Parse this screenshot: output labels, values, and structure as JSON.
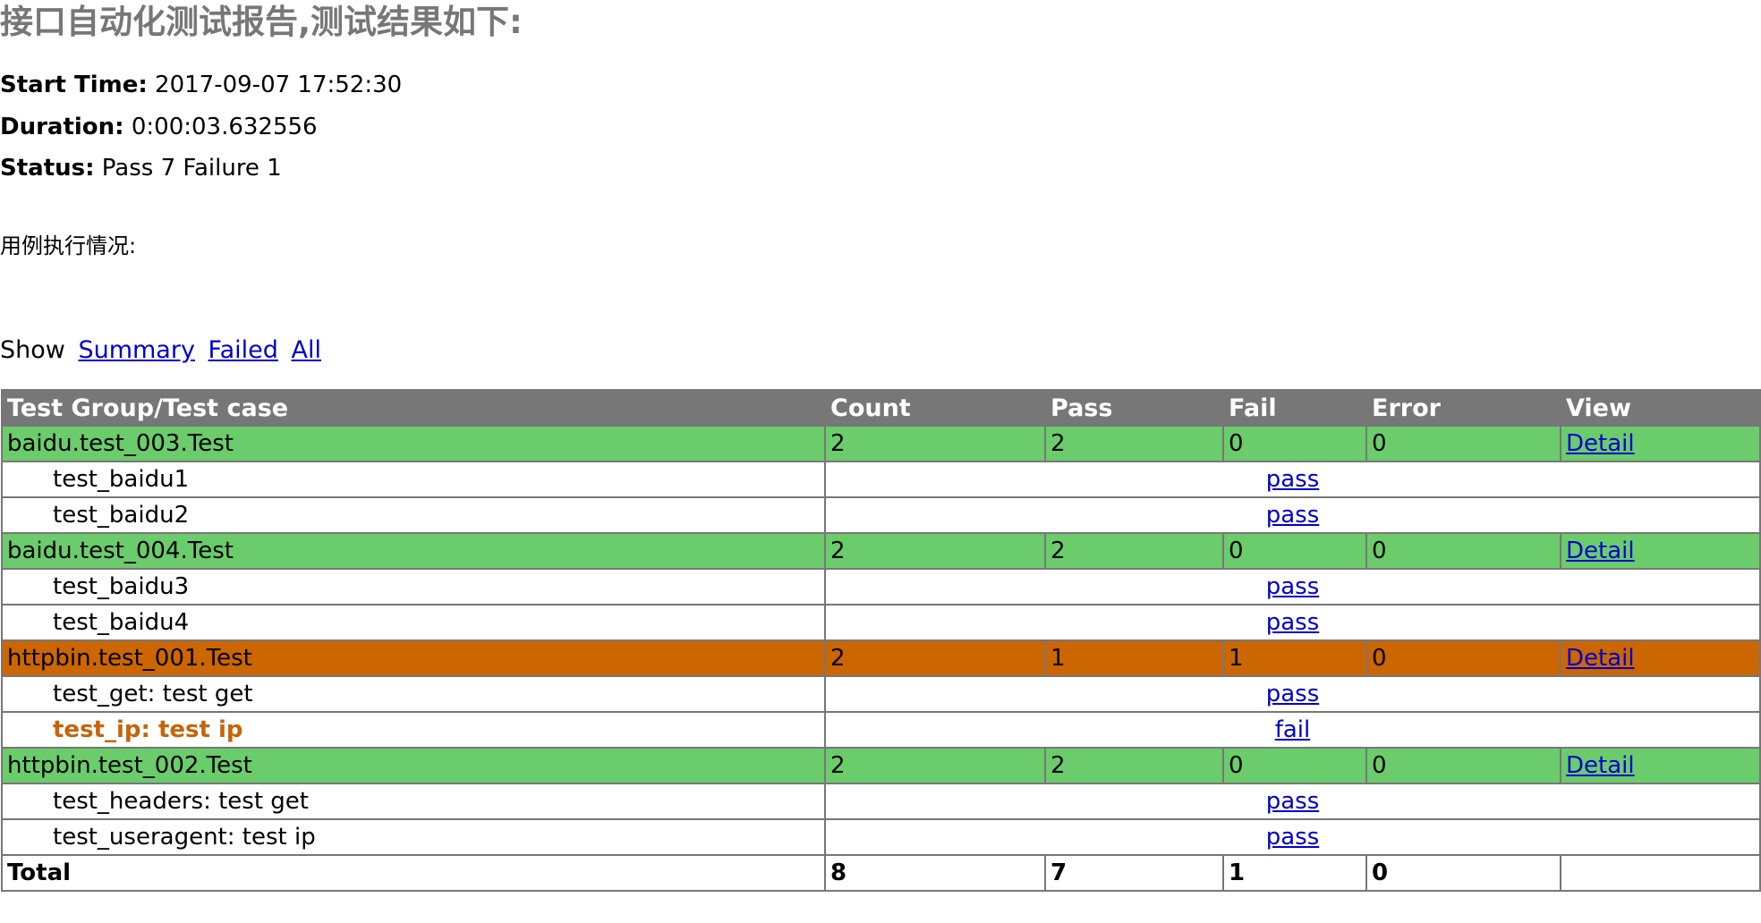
{
  "report": {
    "title": "接口自动化测试报告,测试结果如下:",
    "start_time_label": "Start Time:",
    "start_time_value": "2017-09-07 17:52:30",
    "duration_label": "Duration:",
    "duration_value": "0:00:03.632556",
    "status_label": "Status:",
    "status_value": "Pass 7 Failure 1",
    "description": "用例执行情况:"
  },
  "filter": {
    "label": "Show",
    "summary": "Summary",
    "failed": "Failed",
    "all": "All"
  },
  "table": {
    "headers": [
      "Test Group/Test case",
      "Count",
      "Pass",
      "Fail",
      "Error",
      "View"
    ],
    "groups": [
      {
        "name": "baidu.test_003.Test",
        "count": "2",
        "pass": "2",
        "fail": "0",
        "error": "0",
        "view": "Detail",
        "cases": [
          {
            "name": "test_baidu1",
            "status": "pass"
          },
          {
            "name": "test_baidu2",
            "status": "pass"
          }
        ]
      },
      {
        "name": "baidu.test_004.Test",
        "count": "2",
        "pass": "2",
        "fail": "0",
        "error": "0",
        "view": "Detail",
        "cases": [
          {
            "name": "test_baidu3",
            "status": "pass"
          },
          {
            "name": "test_baidu4",
            "status": "pass"
          }
        ]
      },
      {
        "name": "httpbin.test_001.Test",
        "count": "2",
        "pass": "1",
        "fail": "1",
        "error": "0",
        "view": "Detail",
        "cases": [
          {
            "name": "test_get: test get",
            "status": "pass"
          },
          {
            "name": "test_ip: test ip",
            "status": "fail"
          }
        ]
      },
      {
        "name": "httpbin.test_002.Test",
        "count": "2",
        "pass": "2",
        "fail": "0",
        "error": "0",
        "view": "Detail",
        "cases": [
          {
            "name": "test_headers: test get",
            "status": "pass"
          },
          {
            "name": "test_useragent: test ip",
            "status": "pass"
          }
        ]
      }
    ],
    "total": {
      "label": "Total",
      "count": "8",
      "pass": "7",
      "fail": "1",
      "error": "0",
      "view": ""
    }
  },
  "colors": {
    "header_bg": "#777777",
    "pass_class_bg": "#6bcc6b",
    "fail_class_bg": "#cc6600",
    "failed_case_text": "#c5640b",
    "link": "#0000cc"
  }
}
